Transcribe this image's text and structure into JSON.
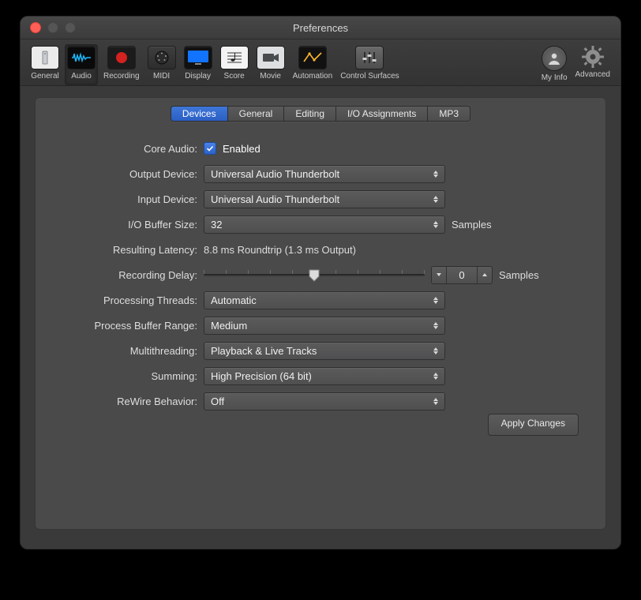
{
  "window": {
    "title": "Preferences"
  },
  "toolbar": {
    "items": [
      {
        "id": "general",
        "label": "General"
      },
      {
        "id": "audio",
        "label": "Audio",
        "active": true
      },
      {
        "id": "recording",
        "label": "Recording"
      },
      {
        "id": "midi",
        "label": "MIDI"
      },
      {
        "id": "display",
        "label": "Display"
      },
      {
        "id": "score",
        "label": "Score"
      },
      {
        "id": "movie",
        "label": "Movie"
      },
      {
        "id": "automation",
        "label": "Automation"
      },
      {
        "id": "control",
        "label": "Control Surfaces"
      },
      {
        "id": "myinfo",
        "label": "My Info"
      },
      {
        "id": "advanced",
        "label": "Advanced"
      }
    ]
  },
  "tabs": {
    "items": [
      {
        "id": "devices",
        "label": "Devices",
        "active": true
      },
      {
        "id": "general",
        "label": "General"
      },
      {
        "id": "editing",
        "label": "Editing"
      },
      {
        "id": "io",
        "label": "I/O Assignments"
      },
      {
        "id": "mp3",
        "label": "MP3"
      }
    ]
  },
  "form": {
    "core_audio_label": "Core Audio:",
    "core_audio_enabled_text": "Enabled",
    "output_device_label": "Output Device:",
    "output_device_value": "Universal Audio Thunderbolt",
    "input_device_label": "Input Device:",
    "input_device_value": "Universal Audio Thunderbolt",
    "io_buffer_label": "I/O Buffer Size:",
    "io_buffer_value": "32",
    "io_buffer_suffix": "Samples",
    "resulting_latency_label": "Resulting Latency:",
    "resulting_latency_value": "8.8 ms Roundtrip (1.3 ms Output)",
    "recording_delay_label": "Recording Delay:",
    "recording_delay_value": "0",
    "recording_delay_suffix": "Samples",
    "processing_threads_label": "Processing Threads:",
    "processing_threads_value": "Automatic",
    "process_buffer_range_label": "Process Buffer Range:",
    "process_buffer_range_value": "Medium",
    "multithreading_label": "Multithreading:",
    "multithreading_value": "Playback & Live Tracks",
    "summing_label": "Summing:",
    "summing_value": "High Precision (64 bit)",
    "rewire_label": "ReWire Behavior:",
    "rewire_value": "Off",
    "apply_button": "Apply Changes"
  }
}
